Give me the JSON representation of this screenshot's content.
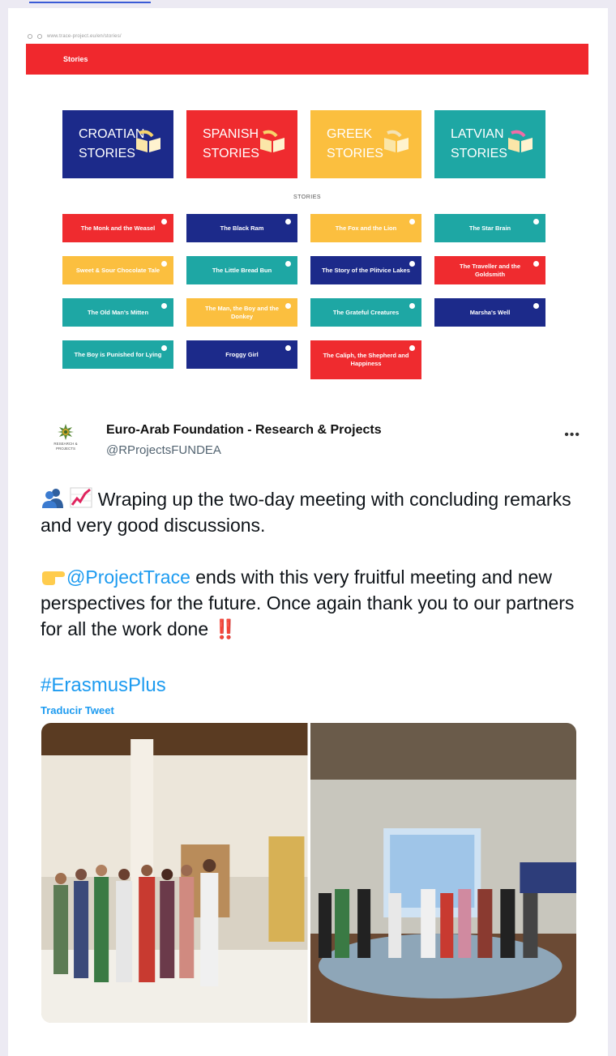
{
  "screenshot": {
    "address_url": "www.trace-project.eu/en/stories/",
    "nav_label": "Stories",
    "big_tiles": [
      {
        "line1": "CROATIAN",
        "line2": "STORIES",
        "color": "#1c2a8a"
      },
      {
        "line1": "SPANISH",
        "line2": "STORIES",
        "color": "#ef2b2f"
      },
      {
        "line1": "GREEK",
        "line2": "STORIES",
        "color": "#fbbf3f"
      },
      {
        "line1": "LATVIAN",
        "line2": "STORIES",
        "color": "#1ea7a4"
      }
    ],
    "stories_label": "STORIES",
    "story_tiles": [
      {
        "title": "The Monk and the Weasel",
        "color": "#ef2b2f"
      },
      {
        "title": "The Black Ram",
        "color": "#1c2a8a"
      },
      {
        "title": "The Fox and the Lion",
        "color": "#fbbf3f"
      },
      {
        "title": "The Star Brain",
        "color": "#1ea7a4"
      },
      {
        "title": "Sweet & Sour Chocolate Tale",
        "color": "#fbbf3f"
      },
      {
        "title": "The Little Bread Bun",
        "color": "#1ea7a4"
      },
      {
        "title": "The Story of the Plitvice Lakes",
        "color": "#1c2a8a"
      },
      {
        "title": "The Traveller and the Goldsmith",
        "color": "#ef2b2f"
      },
      {
        "title": "The Old Man's Mitten",
        "color": "#1ea7a4"
      },
      {
        "title": "The Man, the Boy and the Donkey",
        "color": "#fbbf3f"
      },
      {
        "title": "The Grateful Creatures",
        "color": "#1ea7a4"
      },
      {
        "title": "Marsha's Well",
        "color": "#1c2a8a"
      },
      {
        "title": "The Boy is Punished for Lying",
        "color": "#1ea7a4"
      },
      {
        "title": "Froggy Girl",
        "color": "#1c2a8a"
      },
      {
        "title": "The Caliph, the Shepherd and Happiness",
        "color": "#ef2b2f"
      }
    ]
  },
  "tweet": {
    "logo_text_1": "RESEARCH &",
    "logo_text_2": "PROJECTS",
    "author_name": "Euro-Arab Foundation - Research & Projects",
    "author_handle": "@RProjectsFUNDEA",
    "more_label": "•••",
    "para1": "Wraping up the two-day meeting with concluding remarks and very good discussions.",
    "mention": "@ProjectTrace",
    "para2_rest": " ends with this very fruitful meeting and new perspectives for the future. Once again thank you to our partners for all the work done ",
    "exclamation": "‼️",
    "hashtag": "#ErasmusPlus",
    "translate_label": "Traducir Tweet"
  },
  "icons": [
    "people-icon",
    "chart-icon",
    "pointing-hand-icon",
    "book-icon",
    "more-icon"
  ],
  "colors": {
    "link": "#1d9bf0",
    "accent_red": "#f0282d"
  }
}
